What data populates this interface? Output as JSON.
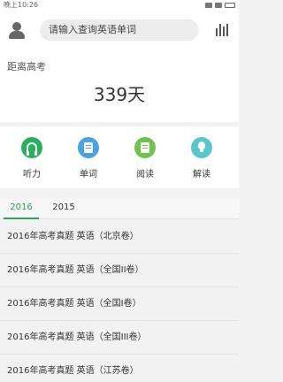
{
  "status_bar": {
    "time": "晚上10:26"
  },
  "header": {
    "search_placeholder": "请输入查询英语单词",
    "avatar_icon": "user-icon",
    "stats_icon": "bar-chart-icon"
  },
  "countdown": {
    "label": "距离高考",
    "value": "339天"
  },
  "features": [
    {
      "label": "听力",
      "icon": "headphones-icon",
      "color": "#2ab05f"
    },
    {
      "label": "单词",
      "icon": "book-icon",
      "color": "#4aa3df"
    },
    {
      "label": "阅读",
      "icon": "document-icon",
      "color": "#6ec44a"
    },
    {
      "label": "解读",
      "icon": "lightbulb-icon",
      "color": "#5bc6c9"
    }
  ],
  "tabs": [
    {
      "label": "2016",
      "active": true
    },
    {
      "label": "2015",
      "active": false
    }
  ],
  "list": [
    "2016年高考真题 英语（北京卷）",
    "2016年高考真题 英语（全国II卷）",
    "2016年高考真题 英语（全国I卷）",
    "2016年高考真题 英语（全国III卷）",
    "2016年高考真题 英语（江苏卷）"
  ],
  "accent_color": "#2aa45a"
}
